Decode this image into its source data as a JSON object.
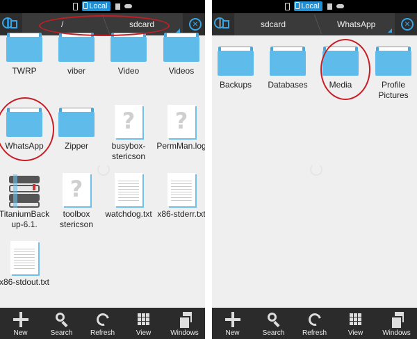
{
  "status_bar": {
    "badge_label": "Local"
  },
  "panels": [
    {
      "path": [
        "/",
        "sdcard"
      ],
      "items": [
        {
          "label": "TWRP",
          "type": "folder"
        },
        {
          "label": "viber",
          "type": "folder"
        },
        {
          "label": "Video",
          "type": "folder"
        },
        {
          "label": "Videos",
          "type": "folder"
        },
        {
          "label": "WhatsApp",
          "type": "folder",
          "highlighted": true
        },
        {
          "label": "Zipper",
          "type": "folder"
        },
        {
          "label": "busybox-stericson",
          "type": "unknown"
        },
        {
          "label": "PermMan.log",
          "type": "unknown"
        },
        {
          "label": "TitaniumBackup-6.1.",
          "type": "app"
        },
        {
          "label": "toolbox stericson",
          "type": "unknown"
        },
        {
          "label": "watchdog.txt",
          "type": "text"
        },
        {
          "label": "x86-stderr.txt",
          "type": "text"
        },
        {
          "label": "x86-stdout.txt",
          "type": "text"
        }
      ]
    },
    {
      "path": [
        "sdcard",
        "WhatsApp"
      ],
      "items": [
        {
          "label": "Backups",
          "type": "folder"
        },
        {
          "label": "Databases",
          "type": "folder"
        },
        {
          "label": "Media",
          "type": "folder",
          "highlighted": true
        },
        {
          "label": "Profile Pictures",
          "type": "folder"
        }
      ]
    }
  ],
  "toolbar": {
    "new": "New",
    "search": "Search",
    "refresh": "Refresh",
    "view": "View",
    "windows": "Windows"
  },
  "colors": {
    "accent": "#37a6e6",
    "folder": "#5fbbe9",
    "highlight": "#c81d25"
  }
}
